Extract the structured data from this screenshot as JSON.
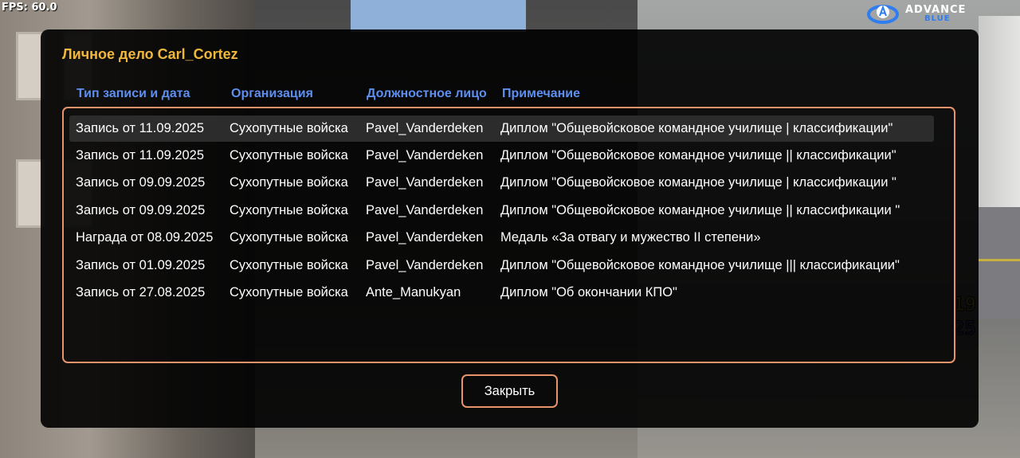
{
  "hud": {
    "fps": "FPS: 60.0",
    "logo_title": "ADVANCE",
    "logo_subtitle": "BLUE",
    "number_top": "19",
    "number_bottom": "25"
  },
  "dialog": {
    "title": "Личное дело Carl_Cortez",
    "columns": [
      "Тип записи и дата",
      "Организация",
      "Должностное лицо",
      "Примечание"
    ],
    "rows": [
      [
        "Запись от 11.09.2025",
        "Сухопутные войска",
        "Pavel_Vanderdeken",
        "Диплом \"Общевойсковое командное училище | классификации\""
      ],
      [
        "Запись от 11.09.2025",
        "Сухопутные войска",
        "Pavel_Vanderdeken",
        "Диплом \"Общевойсковое командное училище || классификации\""
      ],
      [
        "Запись от 09.09.2025",
        "Сухопутные войска",
        "Pavel_Vanderdeken",
        "Диплом \"Общевойсковое командное училище | классификации \""
      ],
      [
        "Запись от 09.09.2025",
        "Сухопутные войска",
        "Pavel_Vanderdeken",
        "Диплом \"Общевойсковое командное училище || классификации \""
      ],
      [
        "Награда от 08.09.2025",
        "Сухопутные войска",
        "Pavel_Vanderdeken",
        "Медаль «За отвагу и мужество II степени»"
      ],
      [
        "Запись от 01.09.2025",
        "Сухопутные войска",
        "Pavel_Vanderdeken",
        "Диплом \"Общевойсковое командное училище ||| классификации\""
      ],
      [
        "Запись от 27.08.2025",
        "Сухопутные войска",
        "Ante_Manukyan",
        "Диплом \"Об окончании КПО\""
      ]
    ],
    "selected_row": 0,
    "close_label": "Закрыть"
  },
  "colors": {
    "title": "#f0b73b",
    "column_header": "#5c8ff0",
    "border_accent": "#e8946a",
    "panel_background": "#000000"
  }
}
